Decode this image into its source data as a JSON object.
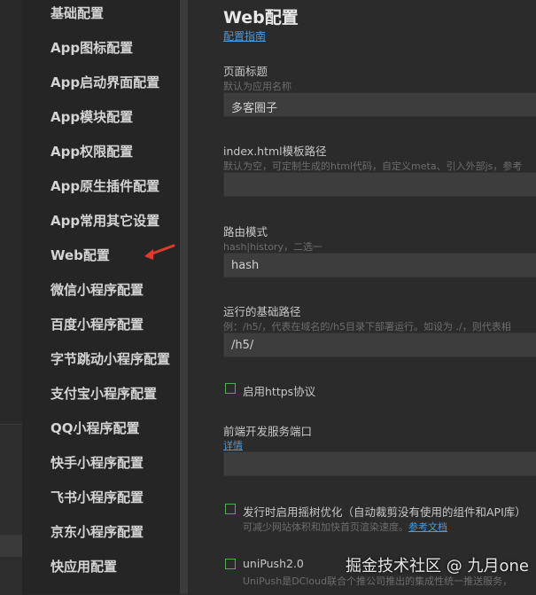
{
  "sidebar": {
    "items": [
      {
        "label": "基础配置"
      },
      {
        "label": "App图标配置"
      },
      {
        "label": "App启动界面配置"
      },
      {
        "label": "App模块配置"
      },
      {
        "label": "App权限配置"
      },
      {
        "label": "App原生插件配置"
      },
      {
        "label": "App常用其它设置"
      },
      {
        "label": "Web配置"
      },
      {
        "label": "微信小程序配置"
      },
      {
        "label": "百度小程序配置"
      },
      {
        "label": "字节跳动小程序配置"
      },
      {
        "label": "支付宝小程序配置"
      },
      {
        "label": "QQ小程序配置"
      },
      {
        "label": "快手小程序配置"
      },
      {
        "label": "飞书小程序配置"
      },
      {
        "label": "京东小程序配置"
      },
      {
        "label": "快应用配置"
      }
    ]
  },
  "main": {
    "title": "Web配置",
    "guide_link": "配置指南",
    "page_title_field": {
      "label": "页面标题",
      "hint": "默认为应用名称",
      "value": "多客圈子"
    },
    "template_field": {
      "label": "index.html模板路径",
      "hint": "默认为空，可定制生成的html代码，自定义meta、引入外部js，参考",
      "value": ""
    },
    "router_field": {
      "label": "路由模式",
      "hint": "hash|history，二选一",
      "value": "hash"
    },
    "base_path_field": {
      "label": "运行的基础路径",
      "hint": "例：/h5/，代表在域名的/h5目录下部署运行。如设为 ./，则代表相",
      "value": "/h5/"
    },
    "https_option": {
      "label": "启用https协议"
    },
    "port_field": {
      "label": "前端开发服务端口",
      "link": "详情",
      "value": ""
    },
    "treeshake_option": {
      "label": "发行时启用摇树优化（自动裁剪没有使用的组件和API库）",
      "hint": "可减少网站体积和加快首页渲染速度。",
      "hint_link": "参考文档"
    },
    "unipush_option": {
      "label": "uniPush2.0",
      "hint": "UniPush是DCloud联合个推公司推出的集成性统一推送服务，"
    }
  },
  "watermark": "掘金技术社区 @ 九月one",
  "colors": {
    "link": "#4a9ce0",
    "checkbox": "#4cae4c",
    "arrow": "#e03a2f"
  }
}
